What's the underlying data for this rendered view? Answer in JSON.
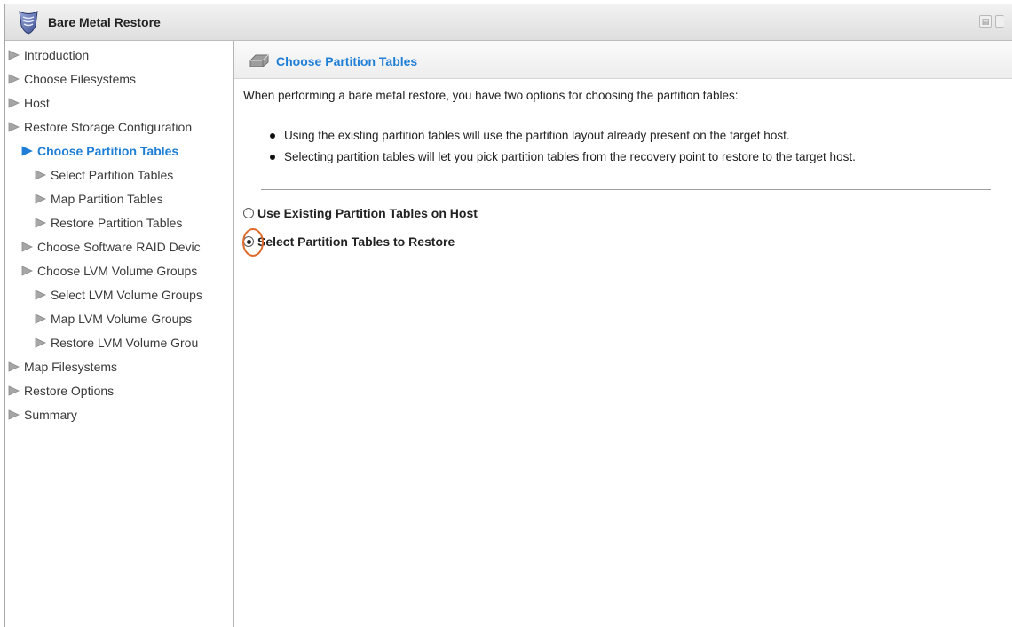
{
  "window": {
    "title": "Bare Metal Restore",
    "app_icon": "shield-icon"
  },
  "sidebar": {
    "items": [
      {
        "label": "Introduction",
        "level": 0,
        "active": false
      },
      {
        "label": "Choose Filesystems",
        "level": 0,
        "active": false
      },
      {
        "label": "Host",
        "level": 0,
        "active": false
      },
      {
        "label": "Restore Storage Configuration",
        "level": 0,
        "active": false
      },
      {
        "label": "Choose Partition Tables",
        "level": 1,
        "active": true
      },
      {
        "label": "Select Partition Tables",
        "level": 2,
        "active": false
      },
      {
        "label": "Map Partition Tables",
        "level": 2,
        "active": false
      },
      {
        "label": "Restore Partition Tables",
        "level": 2,
        "active": false
      },
      {
        "label": "Choose Software RAID Devic",
        "level": 1,
        "active": false
      },
      {
        "label": "Choose LVM Volume Groups",
        "level": 1,
        "active": false
      },
      {
        "label": "Select LVM Volume Groups",
        "level": 2,
        "active": false
      },
      {
        "label": "Map LVM Volume Groups",
        "level": 2,
        "active": false
      },
      {
        "label": "Restore LVM Volume Grou",
        "level": 2,
        "active": false
      },
      {
        "label": "Map Filesystems",
        "level": 0,
        "active": false
      },
      {
        "label": "Restore Options",
        "level": 0,
        "active": false
      },
      {
        "label": "Summary",
        "level": 0,
        "active": false
      }
    ]
  },
  "main": {
    "section_title": "Choose Partition Tables",
    "section_icon": "disk-icon",
    "intro": "When performing a bare metal restore, you have two options for choosing the partition tables:",
    "bullets": [
      "Using the existing partition tables will use the partition layout already present on the target host.",
      "Selecting partition tables will let you pick partition tables from the recovery point to restore to the target host."
    ],
    "options": [
      {
        "label": "Use Existing Partition Tables on Host",
        "checked": false
      },
      {
        "label": "Select Partition Tables to Restore",
        "checked": true
      }
    ]
  },
  "colors": {
    "accent": "#1f7fd6",
    "highlight": "#e06a2c"
  }
}
